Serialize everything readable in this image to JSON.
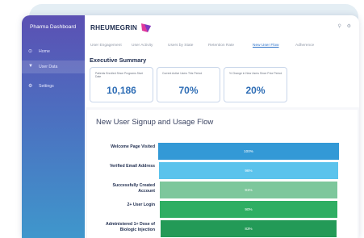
{
  "sidebar": {
    "title": "Pharma Dashboard",
    "items": [
      {
        "icon": "home-icon",
        "glyph": "⊙",
        "label": "Home"
      },
      {
        "icon": "filter-icon",
        "glyph": "▼",
        "label": "User Data"
      },
      {
        "icon": "gear-icon",
        "glyph": "⚙",
        "label": "Settings"
      }
    ]
  },
  "header": {
    "brand": "RHEUMEGRIN",
    "icons": [
      "search-icon",
      "settings-icon"
    ]
  },
  "tabs": [
    {
      "label": "User Engagement"
    },
    {
      "label": "User Activity"
    },
    {
      "label": "Users by State"
    },
    {
      "label": "Retention Rate"
    },
    {
      "label": "New User Flow"
    },
    {
      "label": "Adherence"
    }
  ],
  "active_tab": "New User Flow",
  "summary": {
    "title": "Executive Summary",
    "cards": [
      {
        "label": "Patients Enrolled Since Programs Start Date",
        "value": "10,186"
      },
      {
        "label": "Current Active Users This Period",
        "value": "70%"
      },
      {
        "label": "% Change in New Users Since Prior Period",
        "value": "20%"
      }
    ]
  },
  "funnel": {
    "title": "New User Signup and Usage Flow",
    "stages": [
      {
        "label": "Welcome Page Visited",
        "value": "100%",
        "fraction": 1.0,
        "color": "#3399d6"
      },
      {
        "label": "Verified Email Address",
        "value": "96%",
        "fraction": 0.96,
        "color": "#5bc3ec"
      },
      {
        "label": "Successfully Created Account",
        "value": "91%",
        "fraction": 0.91,
        "color": "#7dc79c"
      },
      {
        "label": "2+ User Login",
        "value": "90%",
        "fraction": 0.9,
        "color": "#2fae63"
      },
      {
        "label": "Administered 1+ Dose of Biologic Injection",
        "value": "83%",
        "fraction": 0.83,
        "color": "#239a57"
      }
    ]
  }
}
